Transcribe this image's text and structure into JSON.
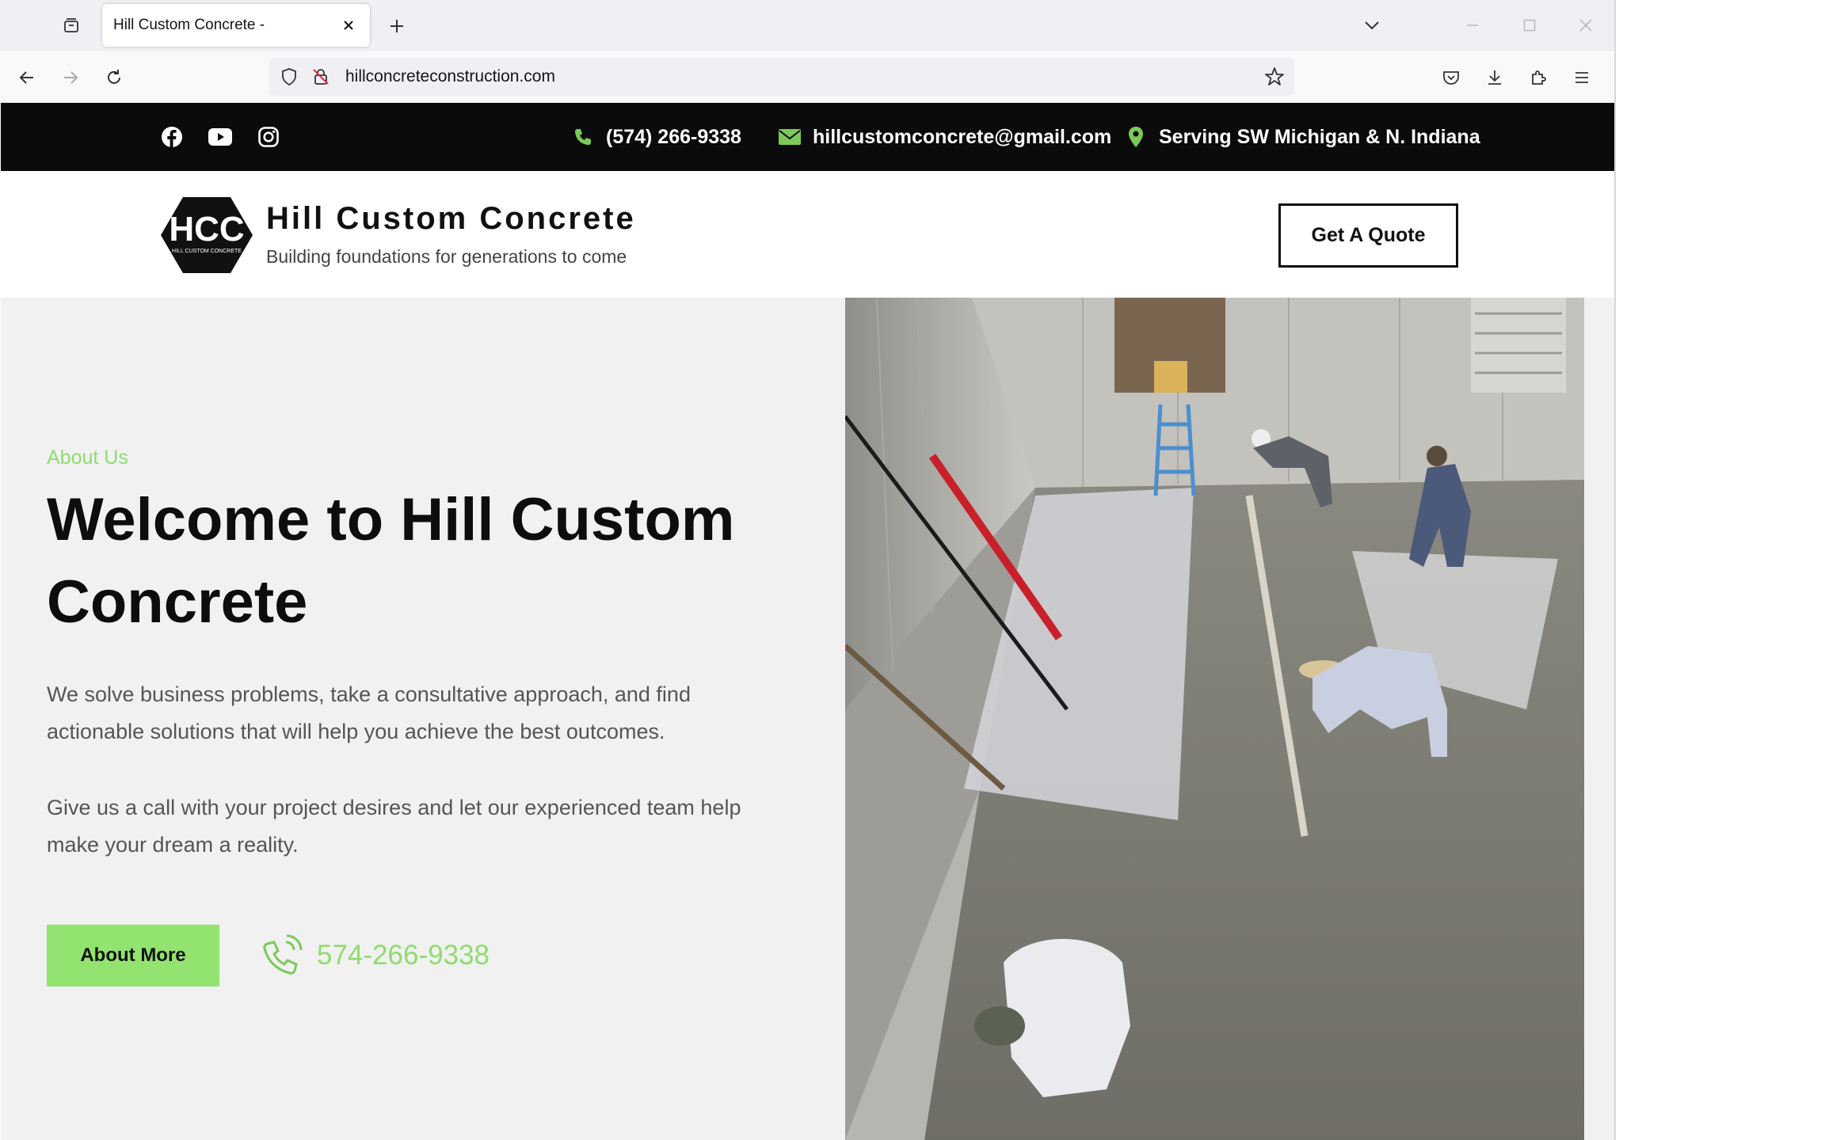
{
  "browser": {
    "tab_title": "Hill Custom Concrete -",
    "url": "hillconcreteconstruction.com"
  },
  "topbar": {
    "social_icons": [
      "facebook-icon",
      "youtube-icon",
      "instagram-icon"
    ],
    "phone": "(574) 266-9338",
    "email": "hillcustomconcrete@gmail.com",
    "location": "Serving SW Michigan & N. Indiana"
  },
  "header": {
    "logo_text": "HCC",
    "logo_subtext": "HILL CUSTOM CONCRETE",
    "brand_name": "Hill Custom Concrete",
    "tagline": "Building foundations for generations to come",
    "quote_button": "Get A Quote"
  },
  "hero": {
    "eyebrow": "About Us",
    "title": "Welcome to Hill Custom Concrete",
    "paragraph_1": "We solve business problems, take a consultative approach, and find actionable solutions that will help you achieve the best outcomes.",
    "paragraph_2": "Give us a call with your project desires and let our experienced team help make your dream a reality.",
    "about_button": "About More",
    "phone": "574-266-9338"
  },
  "colors": {
    "accent_green": "#92e36f",
    "topbar_bg": "#0b0b0b",
    "hero_bg": "#f1f1f1"
  }
}
